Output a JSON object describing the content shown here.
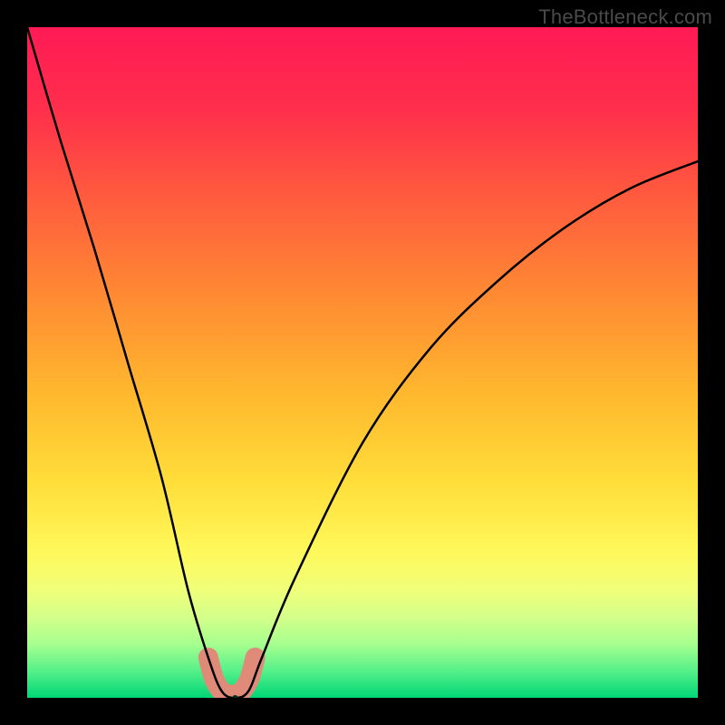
{
  "watermark": "TheBottleneck.com",
  "chart_data": {
    "type": "line",
    "title": "",
    "xlabel": "",
    "ylabel": "",
    "xlim": [
      0,
      100
    ],
    "ylim": [
      0,
      100
    ],
    "annotations": [],
    "series": [
      {
        "name": "bottleneck-curve",
        "x": [
          0,
          5,
          10,
          15,
          20,
          24,
          27,
          29,
          31,
          33,
          35,
          40,
          50,
          60,
          70,
          80,
          90,
          100
        ],
        "values": [
          100,
          83,
          67,
          50,
          33,
          16,
          6,
          1,
          0,
          1,
          6,
          18,
          38,
          52,
          62,
          70,
          76,
          80
        ]
      }
    ],
    "highlight_cluster": {
      "name": "recommended-region",
      "points": [
        {
          "x": 27.0,
          "y": 6.0
        },
        {
          "x": 27.5,
          "y": 4.0
        },
        {
          "x": 28.0,
          "y": 2.5
        },
        {
          "x": 29.0,
          "y": 1.0
        },
        {
          "x": 30.0,
          "y": 0.5
        },
        {
          "x": 31.0,
          "y": 0.5
        },
        {
          "x": 32.0,
          "y": 1.0
        },
        {
          "x": 33.0,
          "y": 2.5
        },
        {
          "x": 33.5,
          "y": 4.0
        },
        {
          "x": 34.0,
          "y": 6.0
        }
      ]
    },
    "gradient_stops": [
      {
        "pos": 0.0,
        "color": "#ff1a55"
      },
      {
        "pos": 0.12,
        "color": "#ff2e4c"
      },
      {
        "pos": 0.25,
        "color": "#ff5a3e"
      },
      {
        "pos": 0.4,
        "color": "#ff8a33"
      },
      {
        "pos": 0.55,
        "color": "#ffb92e"
      },
      {
        "pos": 0.68,
        "color": "#ffde3a"
      },
      {
        "pos": 0.78,
        "color": "#fff85a"
      },
      {
        "pos": 0.84,
        "color": "#f0ff7a"
      },
      {
        "pos": 0.88,
        "color": "#d4ff8a"
      },
      {
        "pos": 0.92,
        "color": "#a6ff8f"
      },
      {
        "pos": 0.96,
        "color": "#55f089"
      },
      {
        "pos": 1.0,
        "color": "#00d676"
      }
    ]
  }
}
